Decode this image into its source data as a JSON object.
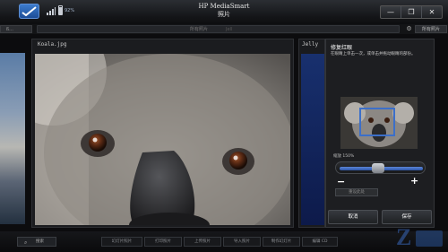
{
  "app": {
    "battery_percent": "92%",
    "title_line1": "HP MediaSmart",
    "title_line2": "照片"
  },
  "toolbar_top": {
    "left_label": "ß...",
    "search_tag": "所有照片",
    "search_placeholder": "Jell",
    "all_label": "所有照片"
  },
  "photo": {
    "filename": "Koala.jpg"
  },
  "next_photo": {
    "filename": "Jelly"
  },
  "edit_panel": {
    "title": "修复红眼",
    "description": "在眼睛上单击一次，或单击并拖动眼睛的部份。",
    "zoom_label": "缩放 150%",
    "zoom_level": 0.45,
    "minus_label": "−",
    "plus_label": "+",
    "reset_label": "重设此处",
    "cancel_label": "取消",
    "save_label": "保存"
  },
  "bottom": {
    "search_label": "搜索",
    "tools": [
      "幻灯片照片",
      "打印照片",
      "上传照片",
      "导入照片",
      "制作幻灯片",
      "编辑 CD"
    ]
  },
  "colors": {
    "accent": "#3c6fc9",
    "panel_bg": "#1d1e21",
    "background": "#0c0c0e"
  },
  "icons": {
    "logo": "check-swoosh-icon",
    "signal": "signal-bars-icon",
    "battery": "battery-icon",
    "minimize": "minimize-icon",
    "restore": "restore-icon",
    "close": "close-icon",
    "settings": "gear-icon",
    "search": "search-icon"
  }
}
